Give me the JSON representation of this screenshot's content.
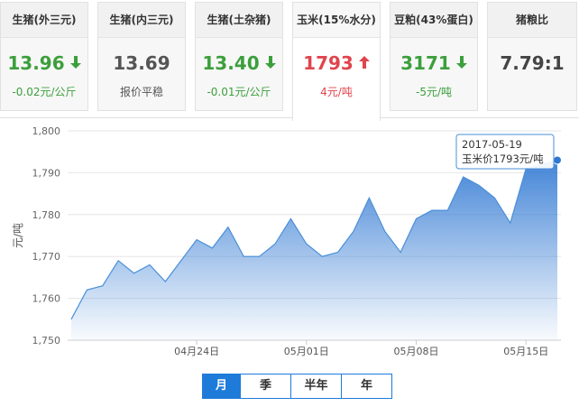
{
  "tabs": [
    {
      "title": "生猪(外三元)",
      "price": "13.96",
      "change": "-0.02元/公斤",
      "trend": "down"
    },
    {
      "title": "生猪(内三元)",
      "price": "13.69",
      "change": "报价平稳",
      "trend": "flat"
    },
    {
      "title": "生猪(土杂猪)",
      "price": "13.40",
      "change": "-0.01元/公斤",
      "trend": "down"
    },
    {
      "title": "玉米(15%水分)",
      "price": "1793",
      "change": "4元/吨",
      "trend": "up"
    },
    {
      "title": "豆粕(43%蛋白)",
      "price": "3171",
      "change": "-5元/吨",
      "trend": "down"
    },
    {
      "title": "猪粮比",
      "price": "7.79:1",
      "change": "",
      "trend": "none"
    }
  ],
  "active_tab": 3,
  "periods": [
    "月",
    "季",
    "半年",
    "年"
  ],
  "active_period": 0,
  "colors": {
    "accent": "#1e7bd9",
    "up": "#e0454d",
    "down": "#3c9f3c",
    "line": "#4a8fd8"
  },
  "tooltip": {
    "date": "2017-05-19",
    "text": "玉米价1793元/吨"
  },
  "chart_data": {
    "type": "area",
    "ylabel": "元/吨",
    "ylim": [
      1750,
      1800
    ],
    "yticks": [
      "1,800",
      "1,790",
      "1,780",
      "1,770",
      "1,760",
      "1,750"
    ],
    "xticks": [
      {
        "label": "04月24日",
        "index": 8
      },
      {
        "label": "05月01日",
        "index": 15
      },
      {
        "label": "05月08日",
        "index": 22
      },
      {
        "label": "05月15日",
        "index": 29
      }
    ],
    "x": [
      "04-16",
      "04-17",
      "04-18",
      "04-19",
      "04-20",
      "04-21",
      "04-22",
      "04-23",
      "04-24",
      "04-25",
      "04-26",
      "04-27",
      "04-28",
      "04-29",
      "04-30",
      "05-01",
      "05-02",
      "05-03",
      "05-04",
      "05-05",
      "05-06",
      "05-07",
      "05-08",
      "05-09",
      "05-10",
      "05-11",
      "05-12",
      "05-13",
      "05-14",
      "05-15",
      "05-16",
      "05-17",
      "05-18",
      "05-19"
    ],
    "values": [
      1755,
      1762,
      1763,
      1769,
      1766,
      1768,
      1764,
      1769,
      1774,
      1772,
      1777,
      1770,
      1770,
      1773,
      1779,
      1773,
      1770,
      1771,
      1776,
      1784,
      1776,
      1771,
      1779,
      1781,
      1781,
      1789,
      1787,
      1784,
      1778,
      1791,
      1792,
      1793
    ],
    "grid": true
  }
}
